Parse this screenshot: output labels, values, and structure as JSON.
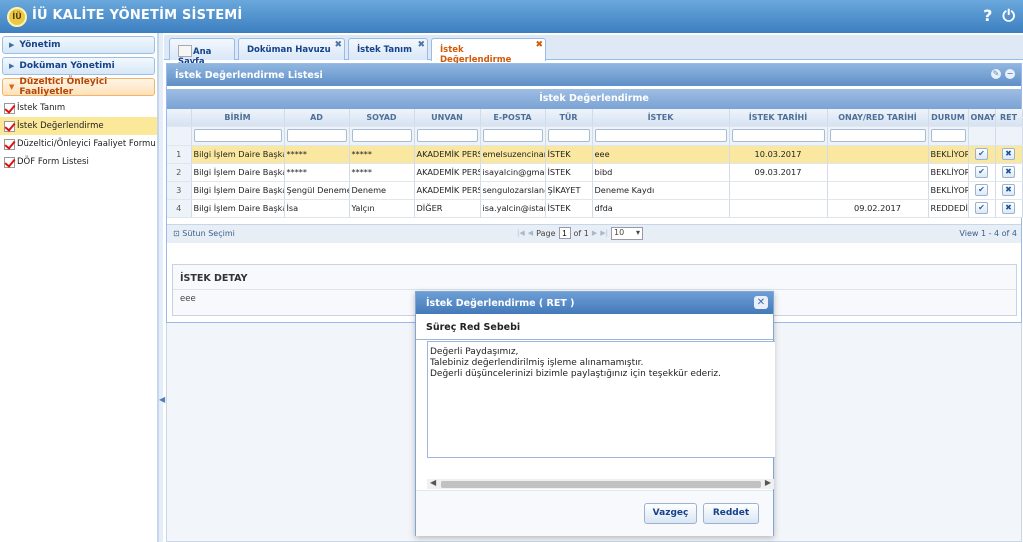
{
  "app": {
    "title": "İÜ KALİTE YÖNETİM SİSTEMİ",
    "logo_icon": "university-seal-icon",
    "help_icon": "?",
    "power_icon": "⏻"
  },
  "sidebar": {
    "sections": [
      {
        "label": "Yönetim",
        "active": false
      },
      {
        "label": "Doküman Yönetimi",
        "active": false
      },
      {
        "label": "Düzeltici Önleyici Faaliyetler",
        "active": true
      }
    ],
    "items": [
      {
        "label": "İstek Tanım",
        "selected": false
      },
      {
        "label": "İstek Değerlendirme",
        "selected": true
      },
      {
        "label": "Düzeltici/Önleyici Faaliyet Formu",
        "selected": false
      },
      {
        "label": "DÖF Form Listesi",
        "selected": false
      }
    ]
  },
  "tabs": [
    {
      "label": "Ana Sayfa",
      "active": false,
      "closable": false
    },
    {
      "label": "Doküman Havuzu",
      "active": false,
      "closable": true
    },
    {
      "label": "İstek Tanım",
      "active": false,
      "closable": true
    },
    {
      "label": "İstek Değerlendirme",
      "active": true,
      "closable": true
    }
  ],
  "panel": {
    "title": "İstek Değerlendirme Listesi",
    "grid_title": "İstek Değerlendirme"
  },
  "grid": {
    "columns": [
      "BİRİM",
      "AD",
      "SOYAD",
      "UNVAN",
      "E-POSTA",
      "TÜR",
      "İSTEK",
      "İSTEK TARİHİ",
      "ONAY/RED TARİHİ",
      "DURUM",
      "ONAY",
      "RET"
    ],
    "rows": [
      {
        "n": "1",
        "birim": "Bilgi İşlem Daire Başkanlığı",
        "ad": "*****",
        "soyad": "*****",
        "unvan": "AKADEMİK PERSONEL",
        "eposta": "emelsuzencinar@istanbul.edu.tr",
        "tur": "İSTEK",
        "istek": "eee",
        "istek_tarihi": "10.03.2017",
        "onay_tarihi": "",
        "durum": "BEKLİYOR",
        "selected": true
      },
      {
        "n": "2",
        "birim": "Bilgi İşlem Daire Başkanlığı",
        "ad": "*****",
        "soyad": "*****",
        "unvan": "AKADEMİK PERSONEL",
        "eposta": "isayalcin@gmail.com",
        "tur": "İSTEK",
        "istek": "bibd",
        "istek_tarihi": "09.03.2017",
        "onay_tarihi": "",
        "durum": "BEKLİYOR",
        "selected": false
      },
      {
        "n": "3",
        "birim": "Bilgi İşlem Daire Başkanlığı",
        "ad": "Şengül Deneme",
        "soyad": "Deneme",
        "unvan": "AKADEMİK PERSONEL",
        "eposta": "sengulozarslan@istanbul.edu.tr",
        "tur": "ŞİKAYET",
        "istek": "Deneme Kaydı",
        "istek_tarihi": "",
        "onay_tarihi": "",
        "durum": "BEKLİYOR",
        "selected": false
      },
      {
        "n": "4",
        "birim": "Bilgi İşlem Daire Başkanlığı",
        "ad": "İsa",
        "soyad": "Yalçın",
        "unvan": "DİĞER",
        "eposta": "isa.yalcin@istanbul.edu.tr",
        "tur": "İSTEK",
        "istek": "dfda",
        "istek_tarihi": "",
        "onay_tarihi": "09.02.2017",
        "durum": "REDDEDİLDİ",
        "selected": false
      }
    ],
    "approve_glyph": "✔",
    "reject_glyph": "✖"
  },
  "pager": {
    "column_select": "Sütun Seçimi",
    "page_label": "Page",
    "page_value": "1",
    "of_label": "of 1",
    "page_size": "10",
    "view_text": "View 1 - 4 of 4"
  },
  "detail": {
    "title": "İSTEK DETAY",
    "body": "eee"
  },
  "modal": {
    "title": "İstek Değerlendirme ( RET )",
    "reason_label": "Süreç Red Sebebi",
    "reason_text": "Değerli Paydaşımız,\nTalebiniz değerlendirilmiş işleme alınamamıştır.\nDeğerli düşüncelerinizi bizimle paylaştığınız için teşekkür ederiz.",
    "cancel_label": "Vazgeç",
    "reject_label": "Reddet"
  }
}
